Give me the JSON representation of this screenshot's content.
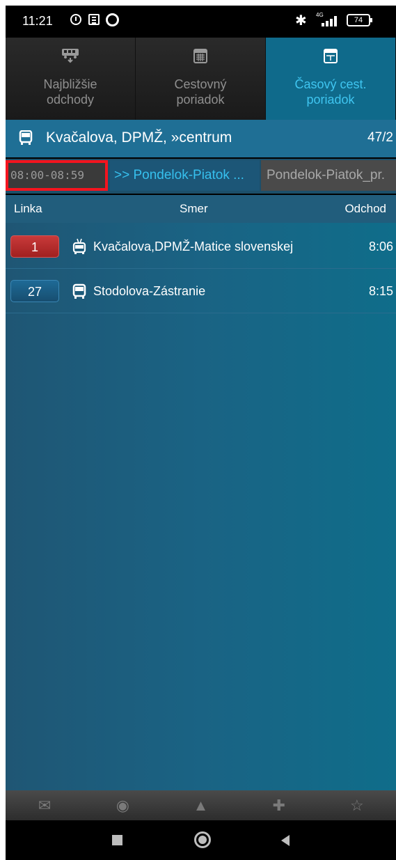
{
  "status_bar": {
    "time": "11:21",
    "bluetooth": "✱",
    "network": "4G",
    "battery": "74"
  },
  "tabs": [
    {
      "label": "Najbližšie\nodchody",
      "icon": "bus-departures-icon"
    },
    {
      "label": "Cestovný\nporiadok",
      "icon": "calendar-grid-icon"
    },
    {
      "label": "Časový cest.\nporiadok",
      "icon": "calendar-time-icon",
      "active": true
    }
  ],
  "stop": {
    "name": "Kvačalova, DPMŽ, »centrum",
    "code": "47/2"
  },
  "filter": {
    "time_range": "08:00-08:59",
    "day_link": ">> Pondelok-Piatok ...",
    "day_type": "Pondelok-Piatok_pr."
  },
  "columns": {
    "line": "Linka",
    "direction": "Smer",
    "departure": "Odchod"
  },
  "departures": [
    {
      "line": "1",
      "vehicle": "trolleybus",
      "destination": "Kvačalova,DPMŽ-Matice slovenskej",
      "time": "8:06",
      "color": "#b02a2a"
    },
    {
      "line": "27",
      "vehicle": "bus",
      "destination": "Stodolova-Zástranie",
      "time": "8:15",
      "color": "#1c5d85"
    }
  ],
  "toolbar": [
    {
      "icon": "mail-icon",
      "glyph": "✉"
    },
    {
      "icon": "globe-icon",
      "glyph": "◉"
    },
    {
      "icon": "navigation-arrow-icon",
      "glyph": "▲"
    },
    {
      "icon": "pin-icon",
      "glyph": "✚"
    },
    {
      "icon": "star-icon",
      "glyph": "☆"
    }
  ],
  "colors": {
    "active_tab": "#0f6a8b",
    "active_tab_text": "#3fc5f0",
    "highlight_border": "#f5141e"
  }
}
